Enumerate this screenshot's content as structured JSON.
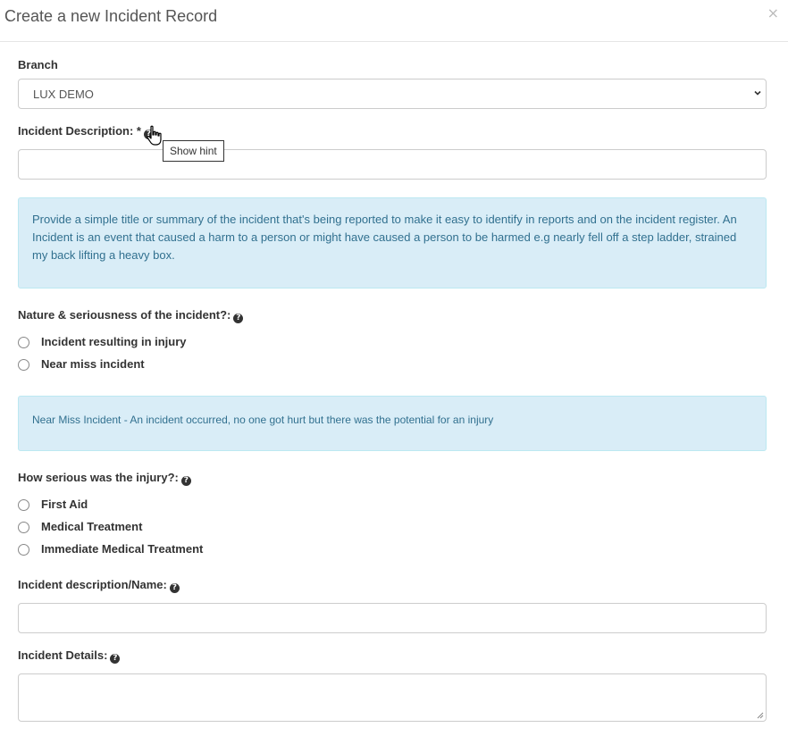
{
  "modal": {
    "title": "Create a new Incident Record",
    "close_glyph": "×"
  },
  "branch": {
    "label": "Branch",
    "selected": "LUX DEMO"
  },
  "incident_description": {
    "label": "Incident Description: *",
    "value": "",
    "tooltip": "Show hint",
    "hint": "Provide a simple title or summary of the incident that's being reported to make it easy to identify in reports and on the incident register.  An Incident is an event that caused a harm to a person or might have caused a person to be harmed e.g nearly fell off a step ladder, strained my back lifting a heavy box."
  },
  "nature": {
    "label": "Nature & seriousness of the incident?:",
    "options": [
      "Incident resulting in injury",
      "Near miss incident"
    ],
    "hint": "Near Miss Incident - An incident occurred, no one got hurt but there was the potential for an injury"
  },
  "injury": {
    "label": "How serious was the injury?:",
    "options": [
      "First Aid",
      "Medical Treatment",
      "Immediate Medical Treatment"
    ]
  },
  "incident_name": {
    "label": "Incident description/Name:",
    "value": ""
  },
  "incident_details": {
    "label": "Incident Details:",
    "value": ""
  },
  "icons": {
    "help": "question-circle-icon",
    "close": "close-icon",
    "cursor": "hand-pointer-icon",
    "dropdown": "chevron-down-icon"
  },
  "colors": {
    "alert_bg": "#d9edf7",
    "alert_text": "#31708f",
    "alert_border": "#bce8f1"
  }
}
